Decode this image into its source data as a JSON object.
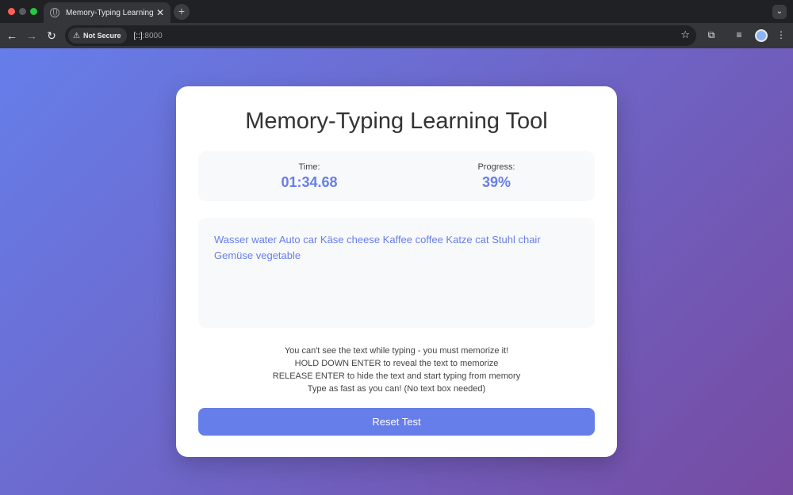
{
  "browser": {
    "tab_title": "Memory-Typing Learning Tool",
    "tab_close": "✕",
    "new_tab": "+",
    "security_label": "Not Secure",
    "url_host": "[::]",
    "url_port": ":8000"
  },
  "app": {
    "title": "Memory-Typing Learning Tool",
    "time_label": "Time:",
    "time_value": "01:34.68",
    "progress_label": "Progress:",
    "progress_value": "39%",
    "memo_text": "Wasser water Auto car Käse cheese Kaffee coffee Katze cat Stuhl chair Gemüse vegetable",
    "instructions": [
      "You can't see the text while typing - you must memorize it!",
      "HOLD DOWN ENTER to reveal the text to memorize",
      "RELEASE ENTER to hide the text and start typing from memory",
      "Type as fast as you can! (No text box needed)"
    ],
    "reset_label": "Reset Test"
  },
  "colors": {
    "accent": "#667eea",
    "gradient_end": "#764ba2"
  },
  "icons": [
    "back-arrow-icon",
    "forward-arrow-icon",
    "reload-icon",
    "warning-icon",
    "star-icon",
    "extensions-icon",
    "media-icon",
    "menu-icon"
  ]
}
